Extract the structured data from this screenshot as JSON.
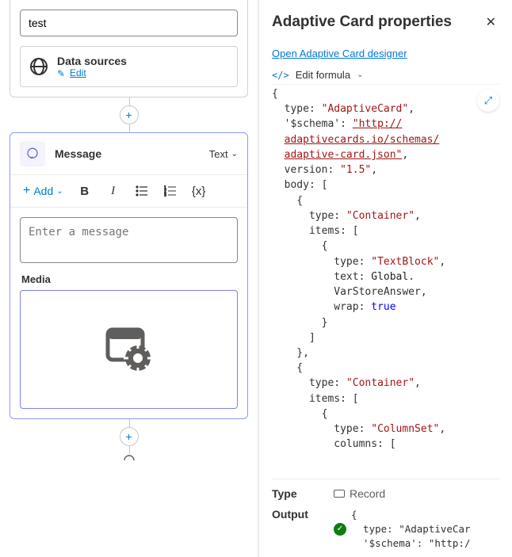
{
  "left": {
    "input_value": "test",
    "data_sources": {
      "title": "Data sources",
      "edit": "Edit"
    },
    "message": {
      "title": "Message",
      "type_label": "Text",
      "toolbar": {
        "add": "Add"
      },
      "placeholder": "Enter a message",
      "media_label": "Media"
    }
  },
  "right": {
    "title": "Adaptive Card properties",
    "designer_link": "Open Adaptive Card designer",
    "formula_label": "Edit formula",
    "code": {
      "type": "AdaptiveCard",
      "schema": "http://adaptivecards.io/schemas/adaptive-card.json",
      "version": "1.5",
      "body_items": [
        {
          "type": "Container",
          "item": {
            "type": "TextBlock",
            "text_ref": "Global.VarStoreAnswer",
            "wrap": "true"
          }
        },
        {
          "type": "Container",
          "item": {
            "type": "ColumnSet",
            "columns": "["
          }
        }
      ]
    },
    "type_row": {
      "label": "Type",
      "value": "Record"
    },
    "output_row": {
      "label": "Output",
      "lines": [
        "{",
        "  type: \"AdaptiveCar",
        "  '$schema': \"http:/"
      ]
    }
  }
}
